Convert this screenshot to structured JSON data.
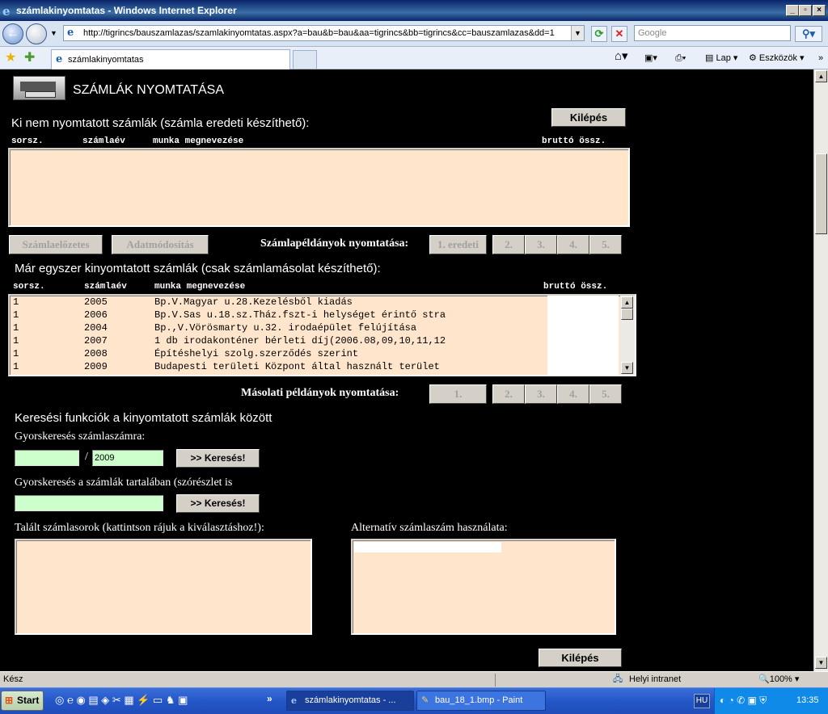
{
  "window": {
    "title": "számlakinyomtatas - Windows Internet Explorer",
    "address": "http://tigrincs/bauszamlazas/szamlakinyomtatas.aspx?a=bau&b=bau&aa=tigrincs&bb=tigrincs&cc=bauszamlazas&dd=1",
    "search_placeholder": "Google",
    "tab_title": "számlakinyomtatas",
    "toolbar_page": "Lap",
    "toolbar_tools": "Eszközök"
  },
  "page": {
    "heading": "SZÁMLÁK NYOMTATÁSA",
    "exit_label": "Kilépés",
    "unprinted": {
      "title": "Ki nem nyomtatott számlák (számla eredeti készíthető):",
      "col_no": "sorsz.",
      "col_year": "számlaév",
      "col_work": "munka megnevezése",
      "col_gross": "bruttó össz."
    },
    "buttons": {
      "preview": "Számlaelőzetes",
      "edit": "Adatmódosítás",
      "print_label": "Számlapéldányok nyomtatása:",
      "orig": "1. eredeti",
      "c2": "2.",
      "c3": "3.",
      "c4": "4.",
      "c5": "5."
    },
    "printed": {
      "title": "Már egyszer kinyomtatott számlák (csak számlamásolat készíthető):",
      "col_no": "sorsz.",
      "col_year": "számlaév",
      "col_work": "munka megnevezése",
      "col_gross": "bruttó össz.",
      "rows": [
        {
          "no": "1",
          "year": "2005",
          "work": "Bp.V.Magyar u.28.Kezelésből kiadás"
        },
        {
          "no": "1",
          "year": "2006",
          "work": "Bp.V.Sas u.18.sz.Tház.fszt-i helységet érintő stra"
        },
        {
          "no": "1",
          "year": "2004",
          "work": "Bp.,V.Vörösmarty u.32. irodaépület felújítása"
        },
        {
          "no": "1",
          "year": "2007",
          "work": "1 db irodakonténer bérleti díj(2006.08,09,10,11,12"
        },
        {
          "no": "1",
          "year": "2008",
          "work": "Építéshelyi szolg.szerződés szerint"
        },
        {
          "no": "1",
          "year": "2009",
          "work": "Budapesti területi Központ által használt terület"
        }
      ]
    },
    "copies": {
      "label": "Másolati példányok nyomtatása:",
      "c1": "1.",
      "c2": "2.",
      "c3": "3.",
      "c4": "4.",
      "c5": "5."
    },
    "search": {
      "title": "Keresési funkciók a kinyomtatott számlák között",
      "quick_no_label": "Gyorskeresés számlaszámra:",
      "slash": "/",
      "year_value": "2009",
      "search_button": ">> Keresés!",
      "content_label": "Gyorskeresés a számlák tartalában (szórészlet is",
      "found_label": "Talált számlasorok (kattintson rájuk a kiválasztáshoz!):",
      "alt_label": "Alternatív számlaszám használata:"
    }
  },
  "status": {
    "text": "Kész",
    "zone": "Helyi intranet",
    "zoom": "100%"
  },
  "taskbar": {
    "start": "Start",
    "task1": "számlakinyomtatas - ...",
    "task2": "bau_18_1.bmp - Paint",
    "lang": "HU",
    "clock": "13:35"
  }
}
